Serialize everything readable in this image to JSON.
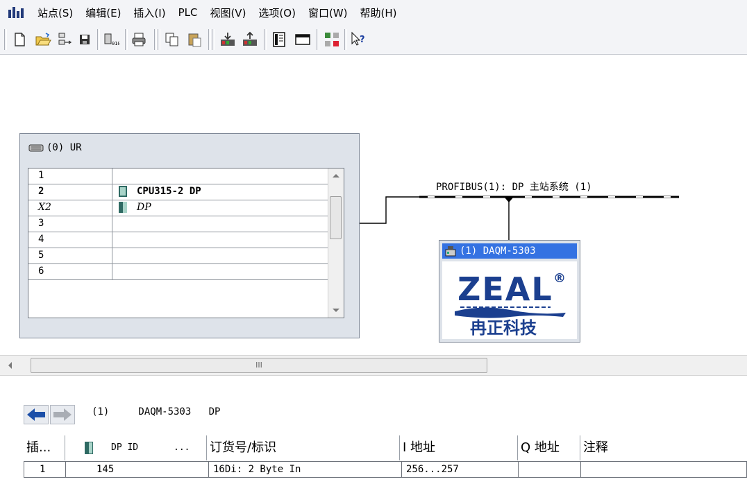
{
  "menu": {
    "items": [
      "站点(S)",
      "编辑(E)",
      "插入(I)",
      "PLC",
      "视图(V)",
      "选项(O)",
      "窗口(W)",
      "帮助(H)"
    ]
  },
  "toolbar": {
    "icons": [
      "new-icon",
      "open-icon",
      "network-icon",
      "save-icon",
      "compile-icon",
      "print-icon",
      "copy-icon",
      "paste-icon",
      "download-icon",
      "upload-icon",
      "overview-icon",
      "detail-view-icon",
      "network-config-icon",
      "help-cursor-icon"
    ]
  },
  "rack": {
    "title": "(0) UR",
    "slots": [
      {
        "slot": "1",
        "module": ""
      },
      {
        "slot": "2",
        "module": "CPU315-2 DP"
      },
      {
        "slot": "X2",
        "module": "DP"
      },
      {
        "slot": "3",
        "module": ""
      },
      {
        "slot": "4",
        "module": ""
      },
      {
        "slot": "5",
        "module": ""
      },
      {
        "slot": "6",
        "module": ""
      }
    ]
  },
  "profibus": {
    "label": "PROFIBUS(1): DP 主站系统 (1)"
  },
  "slave": {
    "title": "(1) DAQM-5303",
    "logo_text": "ZEAL",
    "logo_mark": "®",
    "logo_caption": "冉正科技"
  },
  "hscroll": {
    "grip": "III"
  },
  "detail": {
    "title": "(1)     DAQM-5303   DP",
    "columns": [
      "插...",
      "DP ID",
      "...",
      "订货号/标识",
      "I 地址",
      "Q 地址",
      "注释"
    ],
    "rows": [
      {
        "slot": "1",
        "dp_id": "145",
        "order": "16Di: 2 Byte In",
        "i_addr": "256...257",
        "q_addr": "",
        "comment": ""
      }
    ]
  },
  "colors": {
    "bus_line": "#000000",
    "slave_header": "#3472e2",
    "logo_blue": "#1b3f8f",
    "nav_back": "#1c4fa8"
  }
}
